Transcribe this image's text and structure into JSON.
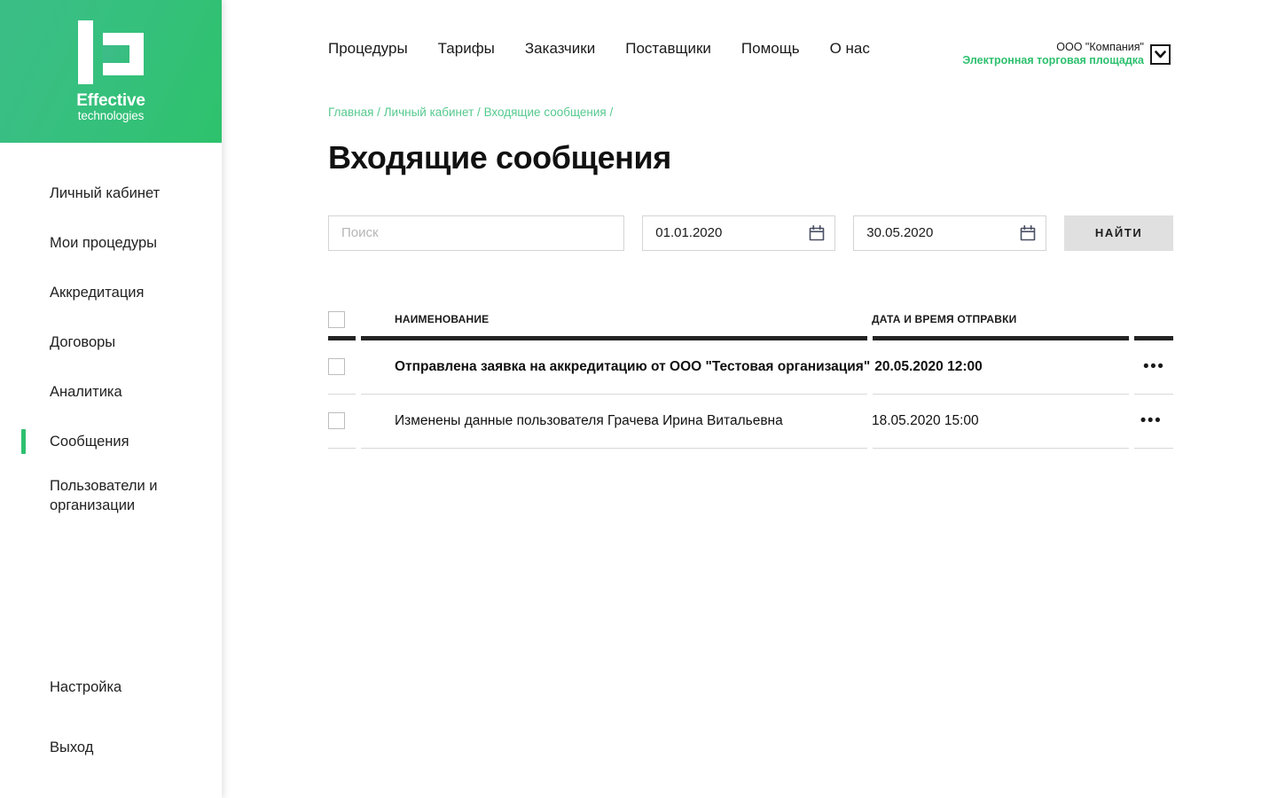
{
  "brand": {
    "logo_line1": "Effective",
    "logo_line2": "technologies",
    "accent_green": "#2ec06f",
    "gradient_from": "#3bbd87",
    "gradient_to": "#2ec26c"
  },
  "sidebar": {
    "items": [
      {
        "label": "Личный кабинет",
        "active": false
      },
      {
        "label": "Мои процедуры",
        "active": false
      },
      {
        "label": "Аккредитация",
        "active": false
      },
      {
        "label": "Договоры",
        "active": false
      },
      {
        "label": "Аналитика",
        "active": false
      },
      {
        "label": "Сообщения",
        "active": true
      },
      {
        "label": "Пользователи и организации",
        "active": false
      }
    ],
    "bottom_items": [
      {
        "label": "Настройка"
      },
      {
        "label": "Выход"
      }
    ]
  },
  "topnav": {
    "links": [
      "Процедуры",
      "Тарифы",
      "Заказчики",
      "Поставщики",
      "Помощь",
      "О нас"
    ]
  },
  "account": {
    "company": "ООО \"Компания\"",
    "platform": "Электронная торговая площадка",
    "toggle_icon": "chevron-down-icon"
  },
  "breadcrumb": {
    "items": [
      "Главная",
      "Личный кабинет",
      "Входящие сообщения"
    ],
    "separator": "/",
    "trailing": "/"
  },
  "page": {
    "title": "Входящие сообщения"
  },
  "filters": {
    "search_placeholder": "Поиск",
    "search_value": "",
    "date_from": "01.01.2020",
    "date_to": "30.05.2020",
    "date_icon": "calendar-icon",
    "submit_label": "Найти"
  },
  "table": {
    "columns": {
      "name": "НАИМЕНОВАНИЕ",
      "date": "ДАТА И ВРЕМЯ ОТПРАВКИ"
    },
    "rows": [
      {
        "name": "Отправлена заявка на аккредитацию от ООО \"Тестовая организация\"",
        "date": "20.05.2020 12:00",
        "unread": true,
        "menu": "•••"
      },
      {
        "name": "Изменены данные пользователя Грачева Ирина Витальевна",
        "date": "18.05.2020 15:00",
        "unread": false,
        "menu": "•••"
      }
    ]
  }
}
